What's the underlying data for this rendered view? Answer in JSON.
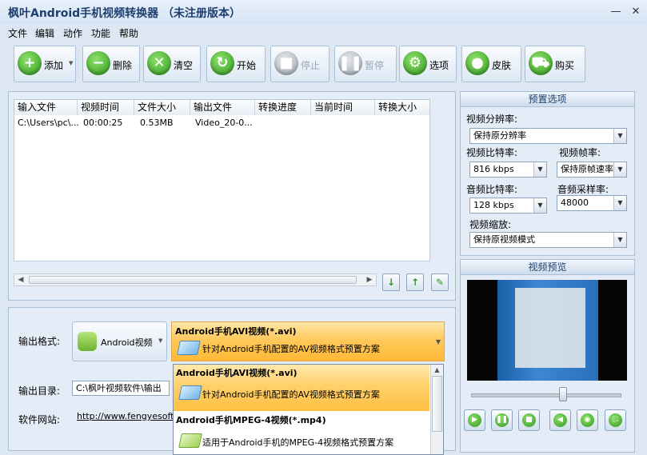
{
  "window": {
    "title": "枫叶Android手机视频转换器 （未注册版本）",
    "minimize_label": "—",
    "close_label": "✕"
  },
  "menu": [
    "文件",
    "编辑",
    "动作",
    "功能",
    "帮助"
  ],
  "toolbar": {
    "add": "添加",
    "add_dropdown": "▼",
    "delete": "删除",
    "clear": "清空",
    "start": "开始",
    "stop": "停止",
    "pause": "暂停",
    "options": "选项",
    "skin": "皮肤",
    "buy": "购买"
  },
  "file_table": {
    "columns": [
      "输入文件",
      "视频时间",
      "文件大小",
      "输出文件",
      "转换进度",
      "当前时间",
      "转换大小"
    ],
    "rows": [
      [
        "C:\\Users\\pc\\...",
        "00:00:25",
        "0.53MB",
        "Video_20-0...",
        "",
        "",
        ""
      ]
    ]
  },
  "list_actions": {
    "down": "↓",
    "up": "↑",
    "edit": "✎"
  },
  "output": {
    "format_label": "输出格式:",
    "format_button": "Android视频",
    "format_button_arrow": "▼",
    "selected_format_title": "Android手机AVI视频(*.avi)",
    "selected_format_desc": "针对Android手机配置的AV视频格式预置方案",
    "dir_label": "输出目录:",
    "dir_value": "C:\\枫叶视频软件\\输出",
    "site_label": "软件网站:",
    "site_url": "http://www.fengyesoft.c"
  },
  "format_dropdown": {
    "items": [
      {
        "title": "Android手机AVI视频(*.avi)",
        "desc": "针对Android手机配置的AV视频格式预置方案",
        "selected": true
      },
      {
        "title": "Android手机MPEG-4视频(*.mp4)",
        "desc": "适用于Android手机的MPEG-4视频格式预置方案",
        "selected": false
      }
    ]
  },
  "presets": {
    "header": "预置选项",
    "resolution_label": "视频分辨率:",
    "resolution_value": "保持原分辨率",
    "video_bitrate_label": "视频比特率:",
    "video_bitrate_value": "816 kbps",
    "frame_rate_label": "视频帧率:",
    "frame_rate_value": "保持原帧速率",
    "audio_bitrate_label": "音频比特率:",
    "audio_bitrate_value": "128 kbps",
    "sample_rate_label": "音频采样率:",
    "sample_rate_value": "48000",
    "scale_label": "视频缩放:",
    "scale_value": "保持原视频模式"
  },
  "preview": {
    "header": "视频预览",
    "slider_position": 0.61
  },
  "colors": {
    "accent": "#2f9a1e",
    "selected_gradient": "#ffc95c",
    "header_text": "#1d3f6e"
  }
}
